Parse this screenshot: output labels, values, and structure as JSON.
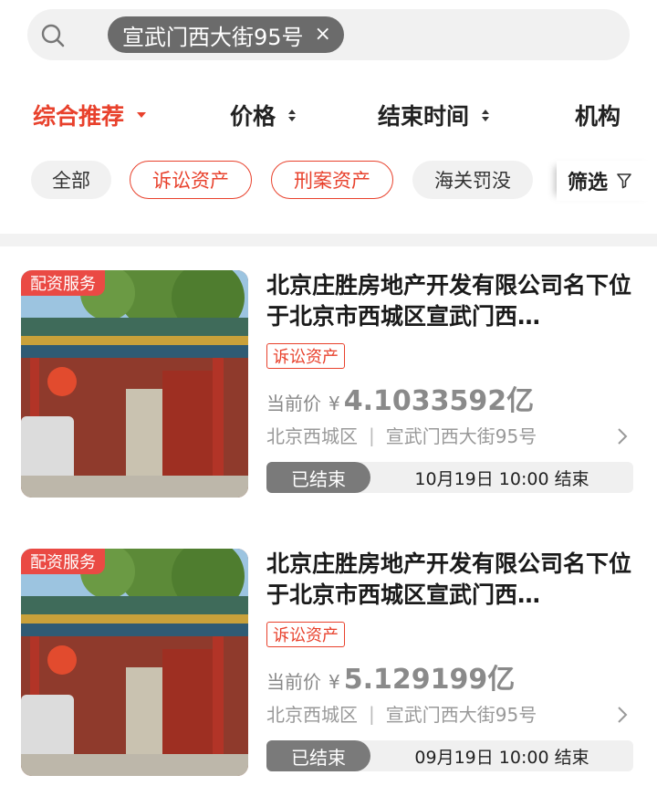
{
  "search": {
    "query_chip": "宣武门西大街95号",
    "clear_symbol": "×"
  },
  "sort": {
    "items": [
      {
        "label": "综合推荐",
        "active": true
      },
      {
        "label": "价格",
        "active": false
      },
      {
        "label": "结束时间",
        "active": false
      },
      {
        "label": "机构",
        "active": false
      }
    ]
  },
  "filters": {
    "pills": [
      {
        "label": "全部",
        "style": "gray"
      },
      {
        "label": "诉讼资产",
        "style": "red"
      },
      {
        "label": "刑案资产",
        "style": "red"
      },
      {
        "label": "海关罚没",
        "style": "gray"
      }
    ],
    "filter_label": "筛选"
  },
  "colors": {
    "accent": "#e8412c",
    "badge": "#ea4a44",
    "status_pill": "#7a7a7a"
  },
  "listings": [
    {
      "badge": "配资服务",
      "title": "北京庄胜房地产开发有限公司名下位于北京市西城区宣武门西…",
      "tag": "诉讼资产",
      "price_label": "当前价",
      "currency": "¥",
      "price": "4.1033592亿",
      "district": "北京西城区",
      "separator": "|",
      "address": "宣武门西大街95号",
      "status": "已结束",
      "end_time": "10月19日 10:00 结束"
    },
    {
      "badge": "配资服务",
      "title": "北京庄胜房地产开发有限公司名下位于北京市西城区宣武门西…",
      "tag": "诉讼资产",
      "price_label": "当前价",
      "currency": "¥",
      "price": "5.129199亿",
      "district": "北京西城区",
      "separator": "|",
      "address": "宣武门西大街95号",
      "status": "已结束",
      "end_time": "09月19日 10:00 结束"
    }
  ]
}
